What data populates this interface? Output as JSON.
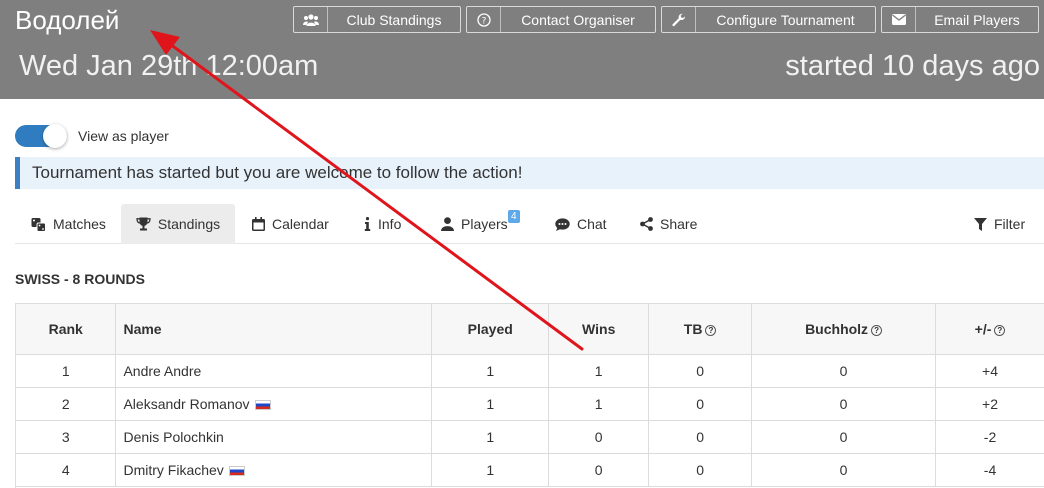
{
  "header": {
    "title": "Водолей",
    "date": "Wed Jan 29th 12:00am",
    "started": "started 10 days ago",
    "buttons": {
      "club_standings": "Club Standings",
      "contact_organiser": "Contact Organiser",
      "configure_tournament": "Configure Tournament",
      "email_players": "Email Players"
    }
  },
  "toggle": {
    "label": "View as player",
    "on": true
  },
  "notice": "Tournament has started but you are welcome to follow the action!",
  "tabs": {
    "matches": "Matches",
    "standings": "Standings",
    "calendar": "Calendar",
    "info": "Info",
    "players": "Players",
    "players_badge": "4",
    "chat": "Chat",
    "share": "Share",
    "filter": "Filter"
  },
  "section_title": "SWISS - 8 ROUNDS",
  "table": {
    "headers": {
      "rank": "Rank",
      "name": "Name",
      "played": "Played",
      "wins": "Wins",
      "tb": "TB",
      "buchholz": "Buchholz",
      "plusminus": "+/-"
    },
    "rows": [
      {
        "rank": "1",
        "name": "Andre Andre",
        "flag": false,
        "played": "1",
        "wins": "1",
        "tb": "0",
        "buchholz": "0",
        "plusminus": "+4"
      },
      {
        "rank": "2",
        "name": "Aleksandr Romanov",
        "flag": true,
        "played": "1",
        "wins": "1",
        "tb": "0",
        "buchholz": "0",
        "plusminus": "+2"
      },
      {
        "rank": "3",
        "name": "Denis Polochkin",
        "flag": false,
        "played": "1",
        "wins": "0",
        "tb": "0",
        "buchholz": "0",
        "plusminus": "-2"
      },
      {
        "rank": "4",
        "name": "Dmitry Fikachev",
        "flag": true,
        "played": "1",
        "wins": "0",
        "tb": "0",
        "buchholz": "0",
        "plusminus": "-4"
      }
    ]
  },
  "colors": {
    "header_bg": "#7f7f7f",
    "accent": "#2f7dc0",
    "notice_bg": "#e8f2fb",
    "arrow": "#e0151b"
  },
  "icons": [
    "users-icon",
    "question-circle-icon",
    "wrench-icon",
    "envelope-icon",
    "dice-icon",
    "trophy-icon",
    "calendar-icon",
    "info-icon",
    "user-icon",
    "comments-icon",
    "share-icon",
    "filter-icon",
    "help-icon",
    "russia-flag-icon"
  ]
}
